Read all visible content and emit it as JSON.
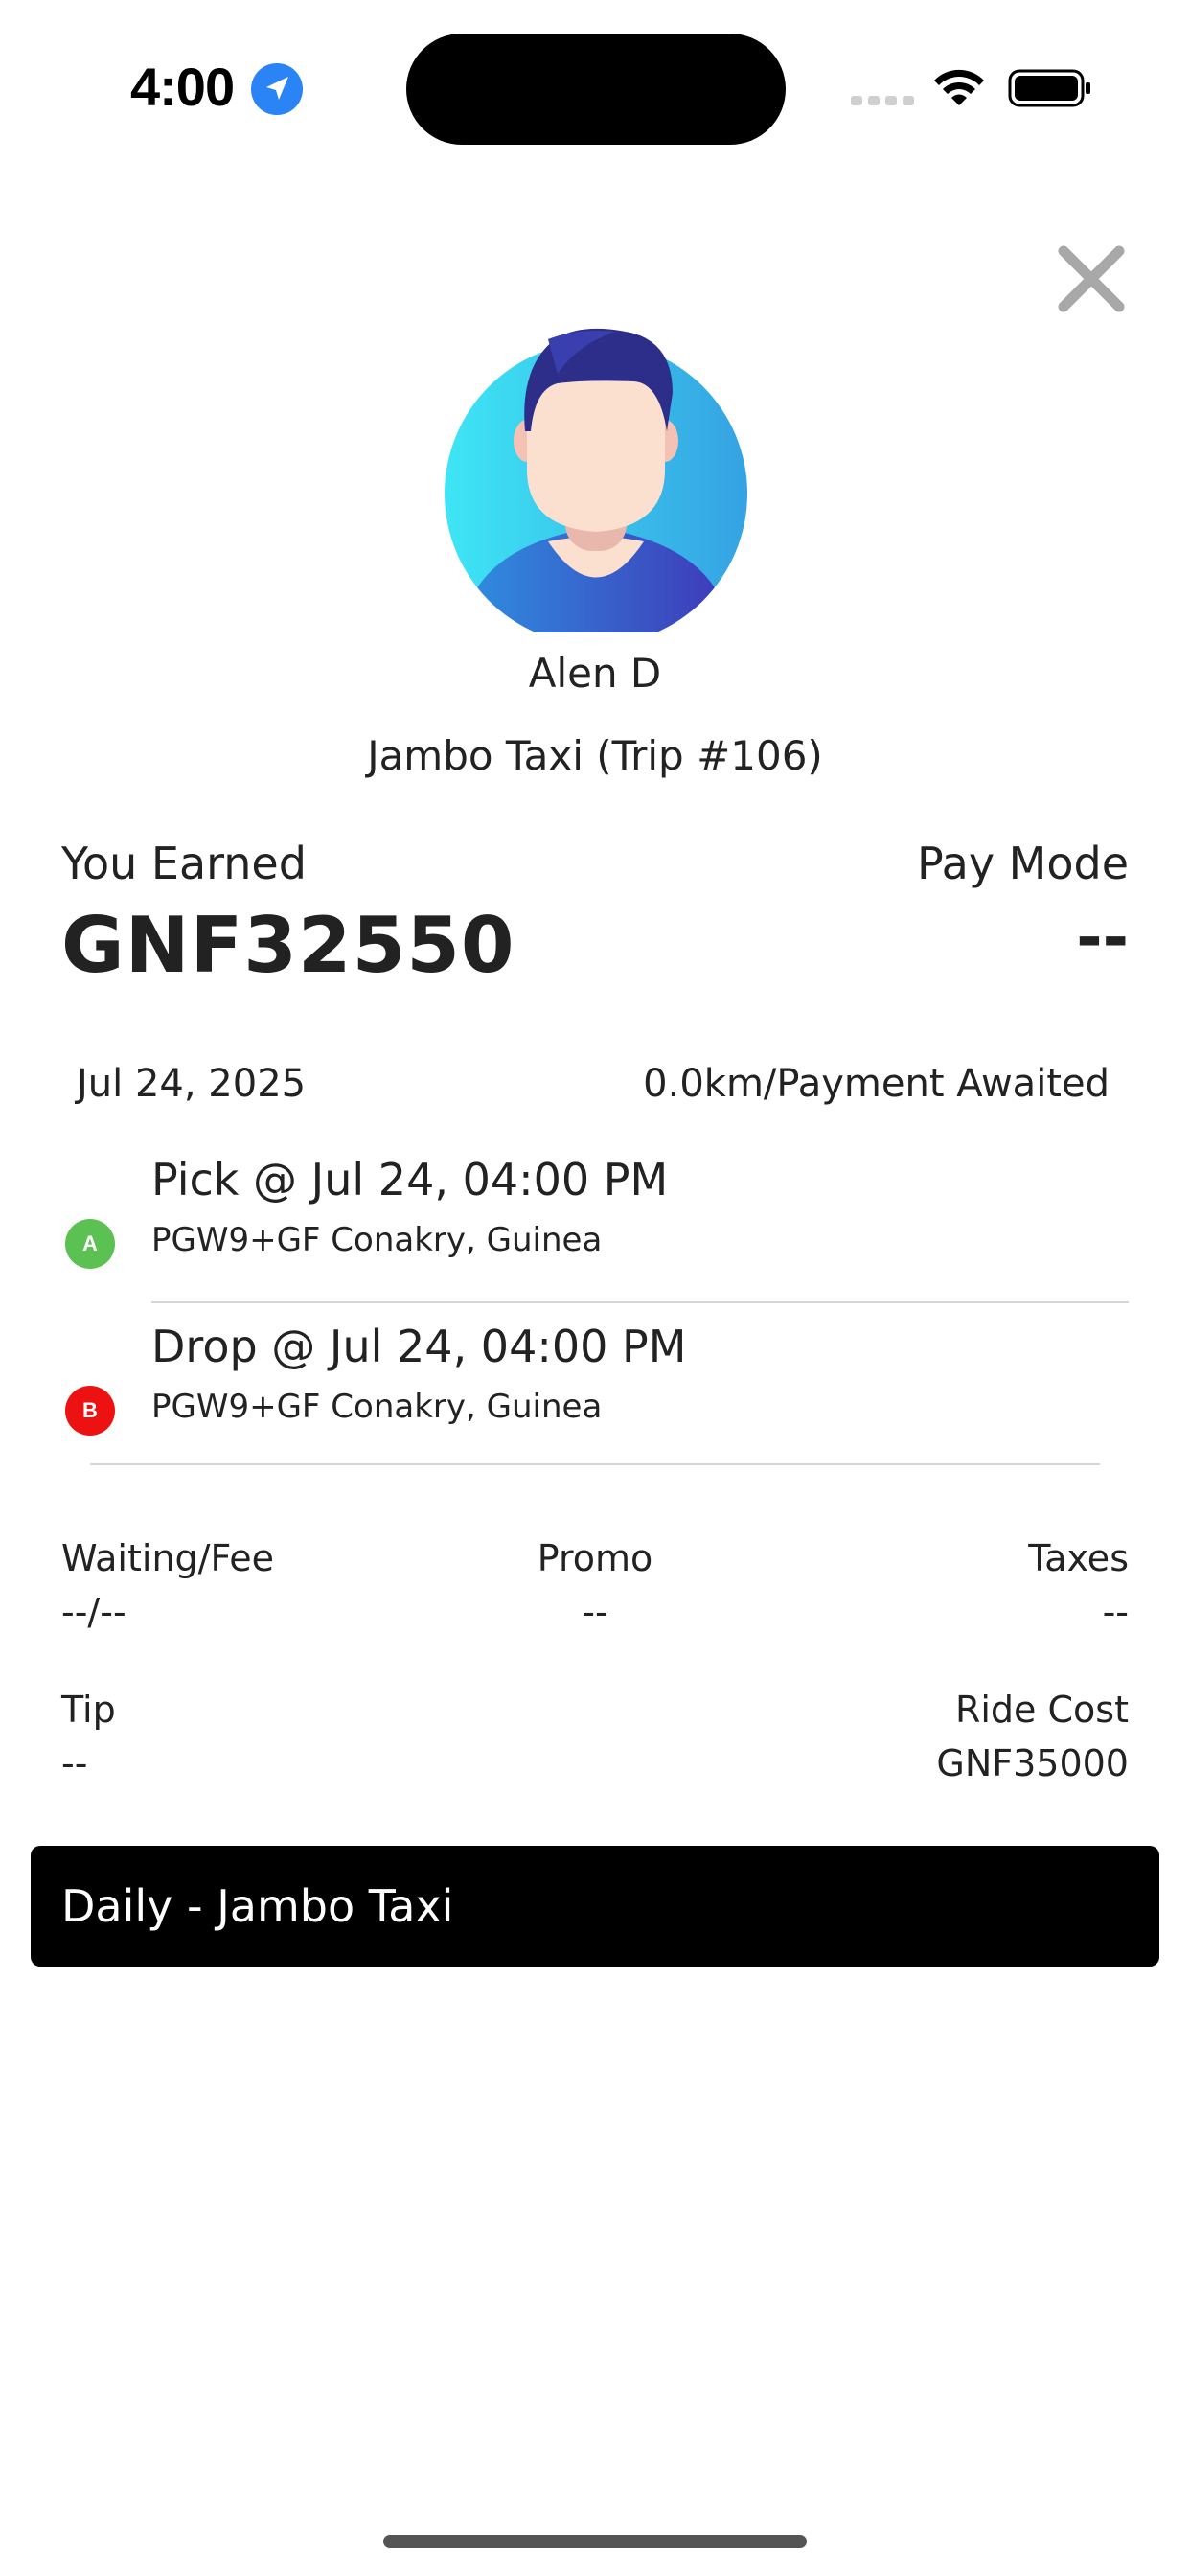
{
  "status_bar": {
    "time": "4:00"
  },
  "driver": {
    "name": "Alen D",
    "trip_title": "Jambo Taxi (Trip #106)"
  },
  "earnings": {
    "label": "You Earned",
    "value": "GNF32550",
    "pay_mode_label": "Pay Mode",
    "pay_mode_value": "--"
  },
  "trip": {
    "date": "Jul 24, 2025",
    "distance_status": "0.0km/Payment Awaited",
    "pick": {
      "marker": "A",
      "time": "Pick @ Jul 24, 04:00 PM",
      "address": "PGW9+GF Conakry, Guinea"
    },
    "drop": {
      "marker": "B",
      "time": "Drop @ Jul 24, 04:00 PM",
      "address": "PGW9+GF Conakry, Guinea"
    }
  },
  "fees": {
    "waiting_label": "Waiting/Fee",
    "waiting_value": "--/--",
    "promo_label": "Promo",
    "promo_value": "--",
    "taxes_label": "Taxes",
    "taxes_value": "--",
    "tip_label": "Tip",
    "tip_value": "--",
    "ride_cost_label": "Ride Cost",
    "ride_cost_value": "GNF35000"
  },
  "banner": {
    "label": "Daily - Jambo Taxi"
  },
  "colors": {
    "pick_marker": "#5cc153",
    "drop_marker": "#ee1111",
    "banner_bg": "#000000"
  },
  "icons": {
    "location": "location-arrow-icon",
    "signal": "cellular-signal-icon",
    "wifi": "wifi-icon",
    "battery": "battery-icon",
    "close": "close-icon",
    "avatar": "user-avatar-icon"
  }
}
